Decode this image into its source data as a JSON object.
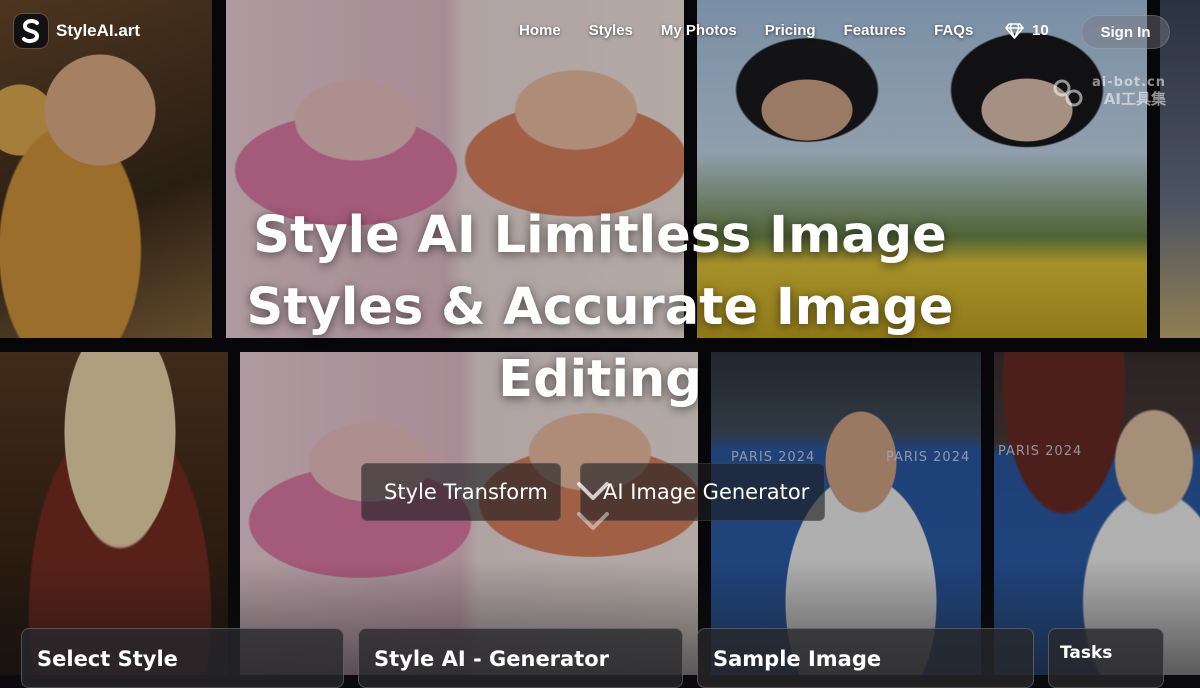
{
  "brand": {
    "name": "StyleAI.art",
    "logo_letter": "S"
  },
  "nav": {
    "items": [
      {
        "label": "Home"
      },
      {
        "label": "Styles"
      },
      {
        "label": "My Photos"
      },
      {
        "label": "Pricing"
      },
      {
        "label": "Features"
      },
      {
        "label": "FAQs"
      }
    ],
    "credits": "10",
    "sign_in": "Sign In"
  },
  "hero": {
    "title_line1": "Style AI Limitless Image",
    "title_line2": "Styles & Accurate Image",
    "title_line3": "Editing",
    "tabs": {
      "style_transform": "Style Transform",
      "ai_image_generator": "AI Image Generator"
    }
  },
  "panels": {
    "select_style": "Select Style",
    "generator": "Style AI - Generator",
    "sample_image": "Sample Image",
    "tasks": "Tasks"
  },
  "background": {
    "banner_text": "PARIS 2024"
  },
  "watermark": {
    "url": "ai-bot.cn",
    "name": "AI工具集"
  },
  "colors": {
    "overlay": "#000000",
    "text": "#ffffff",
    "card_bg": "#28282c"
  }
}
